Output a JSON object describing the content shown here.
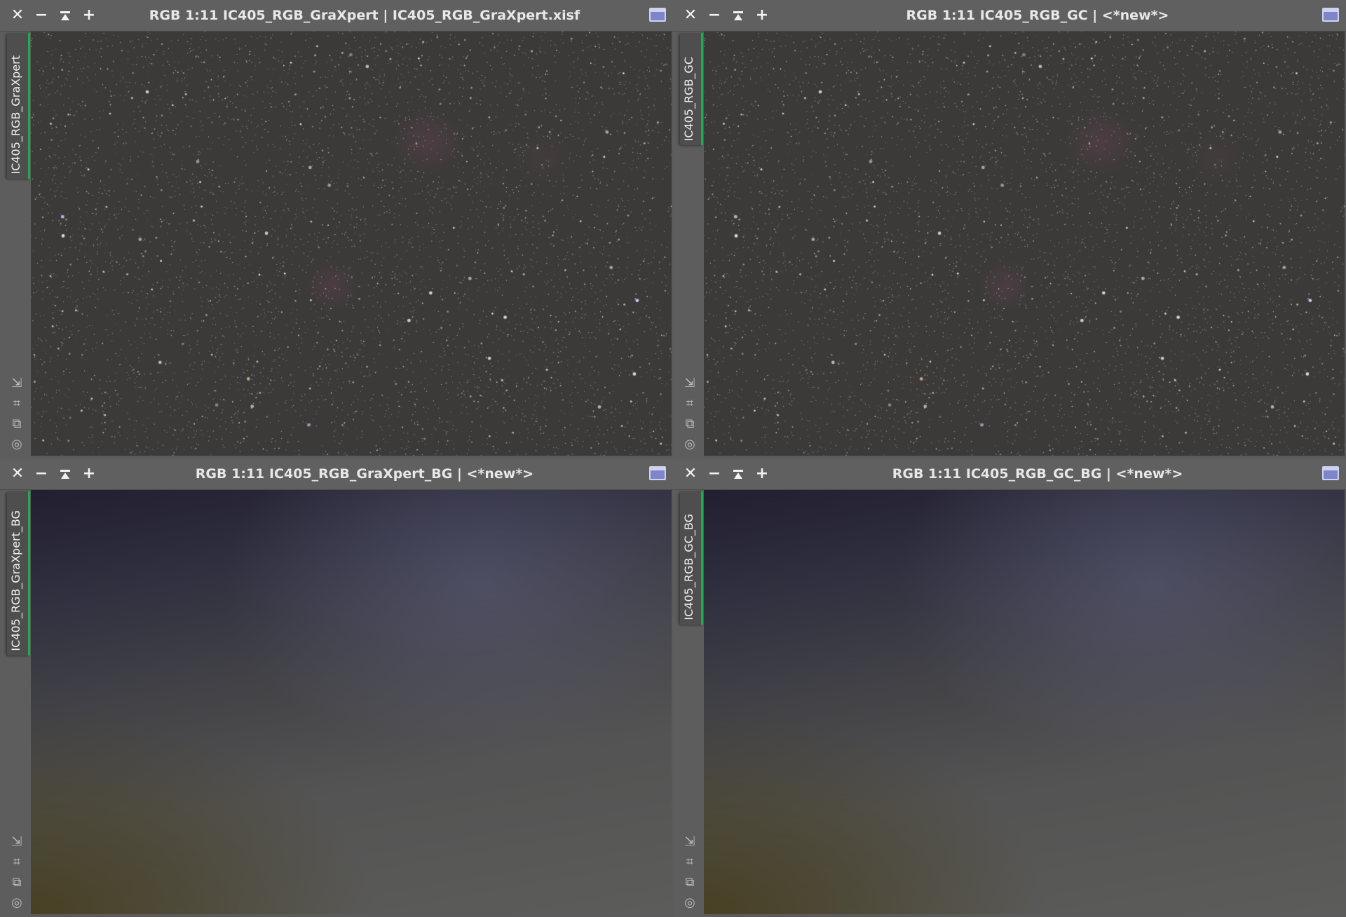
{
  "windows": [
    {
      "title": "RGB 1:11 IC405_RGB_GraXpert | IC405_RGB_GraXpert.xisf",
      "tab_label": "IC405_RGB_GraXpert",
      "content": "starfield"
    },
    {
      "title": "RGB 1:11 IC405_RGB_GC | <*new*>",
      "tab_label": "IC405_RGB_GC",
      "content": "starfield"
    },
    {
      "title": "RGB 1:11 IC405_RGB_GraXpert_BG | <*new*>",
      "tab_label": "IC405_RGB_GraXpert_BG",
      "content": "background-model"
    },
    {
      "title": "RGB 1:11 IC405_RGB_GC_BG | <*new*>",
      "tab_label": "IC405_RGB_GC_BG",
      "content": "background-model"
    }
  ],
  "titlebar_icons": [
    "close-icon",
    "minimize-icon",
    "shade-icon",
    "add-icon",
    "maximize-icon"
  ],
  "sidebar_icons": [
    "resize-icon",
    "crop-icon",
    "clone-icon",
    "target-icon"
  ],
  "colors": {
    "tab_accent": "#19b04c",
    "maximize_button": "#7e86c9",
    "title_text": "#e8e8e8"
  }
}
